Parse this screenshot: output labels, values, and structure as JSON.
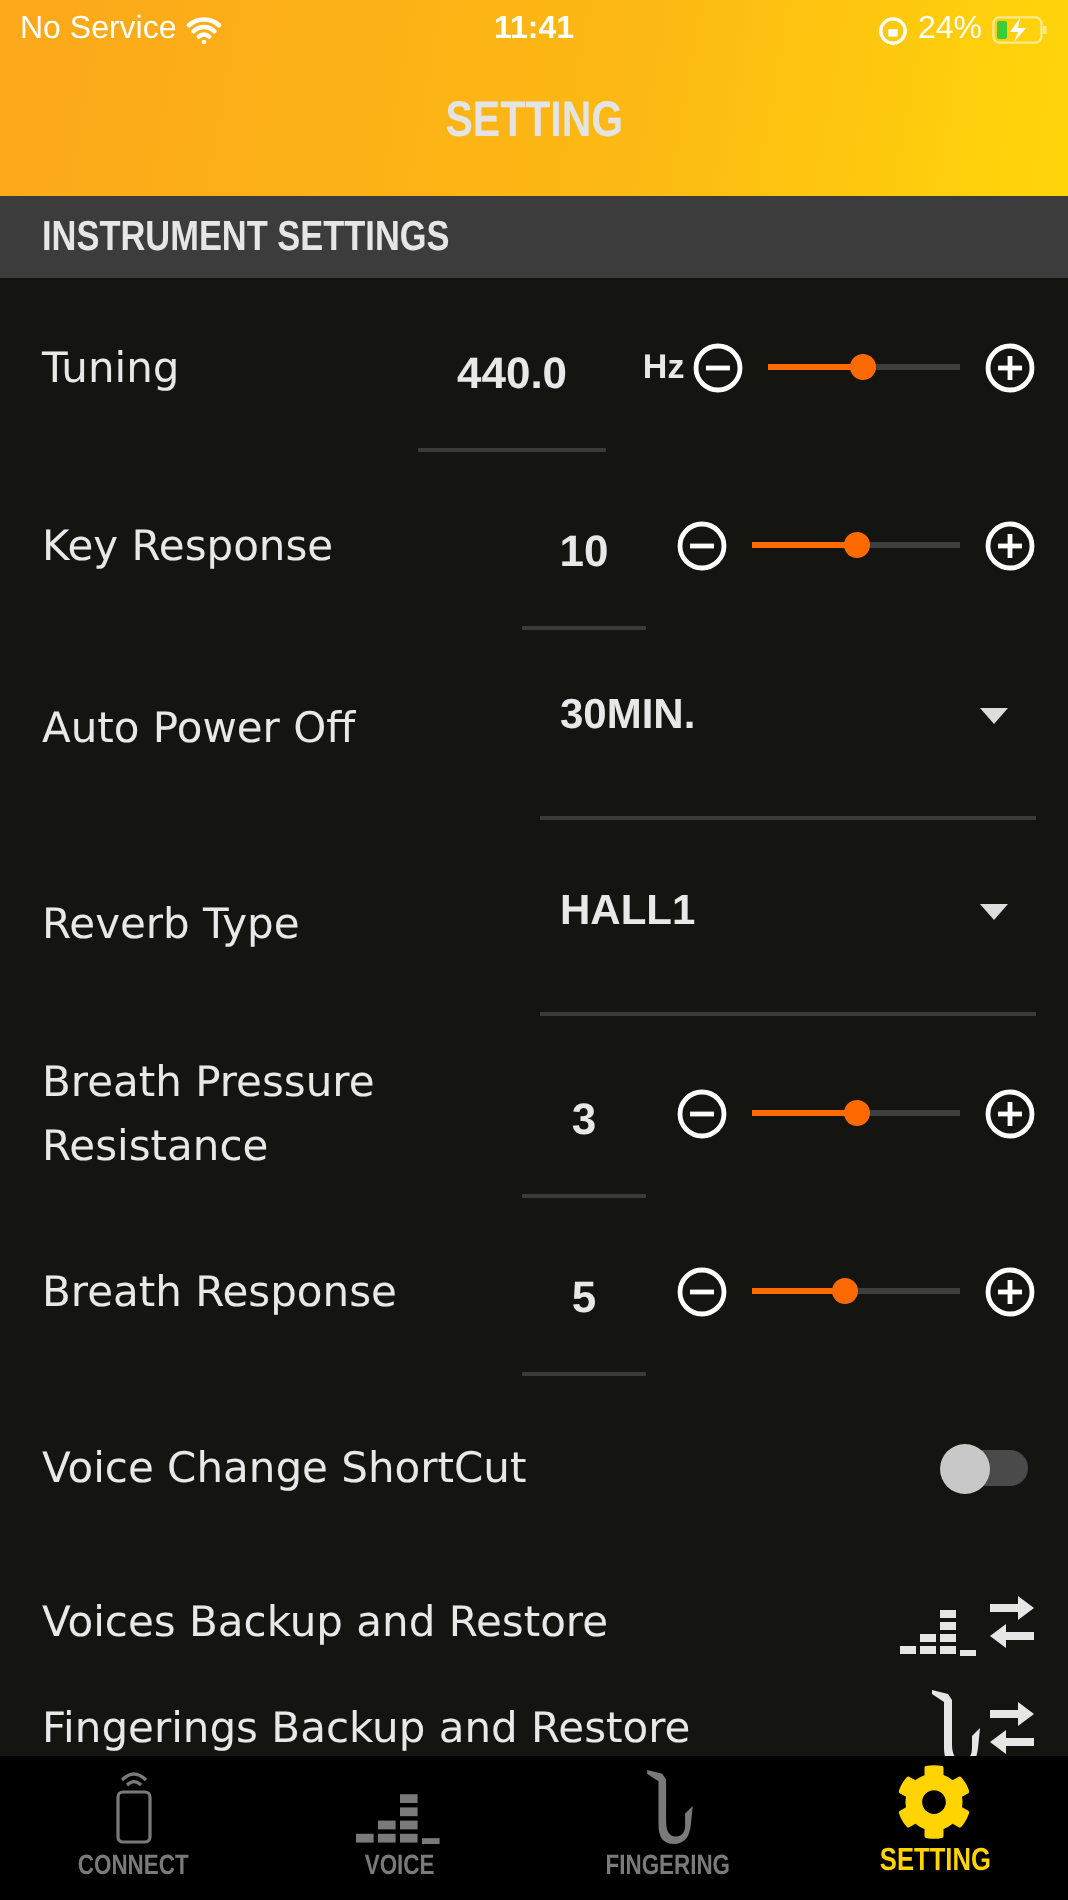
{
  "status_bar": {
    "carrier": "No Service",
    "time": "11:41",
    "battery": "24%"
  },
  "header": {
    "title": "SETTING"
  },
  "section": {
    "title": "INSTRUMENT SETTINGS"
  },
  "rows": [
    {
      "kind": "slider",
      "label": "Tuning",
      "value": "440.0",
      "unit": "Hz",
      "level": 0.49
    },
    {
      "kind": "slider",
      "label": "Key Response",
      "value": "10",
      "level": 0.5
    },
    {
      "kind": "select",
      "label": "Auto Power Off",
      "value": "30MIN."
    },
    {
      "kind": "select",
      "label": "Reverb Type",
      "value": "HALL1"
    },
    {
      "kind": "slider",
      "label": "Breath Pressure Resistance",
      "value": "3",
      "level": 0.5
    },
    {
      "kind": "slider",
      "label": "Breath Response",
      "value": "5",
      "level": 0.44
    },
    {
      "kind": "toggle",
      "label": "Voice Change ShortCut",
      "on": false
    },
    {
      "kind": "backup",
      "label": "Voices Backup and Restore"
    },
    {
      "kind": "backup",
      "label": "Fingerings Backup and Restore"
    }
  ],
  "tabs": [
    {
      "label": "CONNECT",
      "selected": false
    },
    {
      "label": "VOICE",
      "selected": false
    },
    {
      "label": "FINGERING",
      "selected": false
    },
    {
      "label": "SETTING",
      "selected": true
    }
  ]
}
